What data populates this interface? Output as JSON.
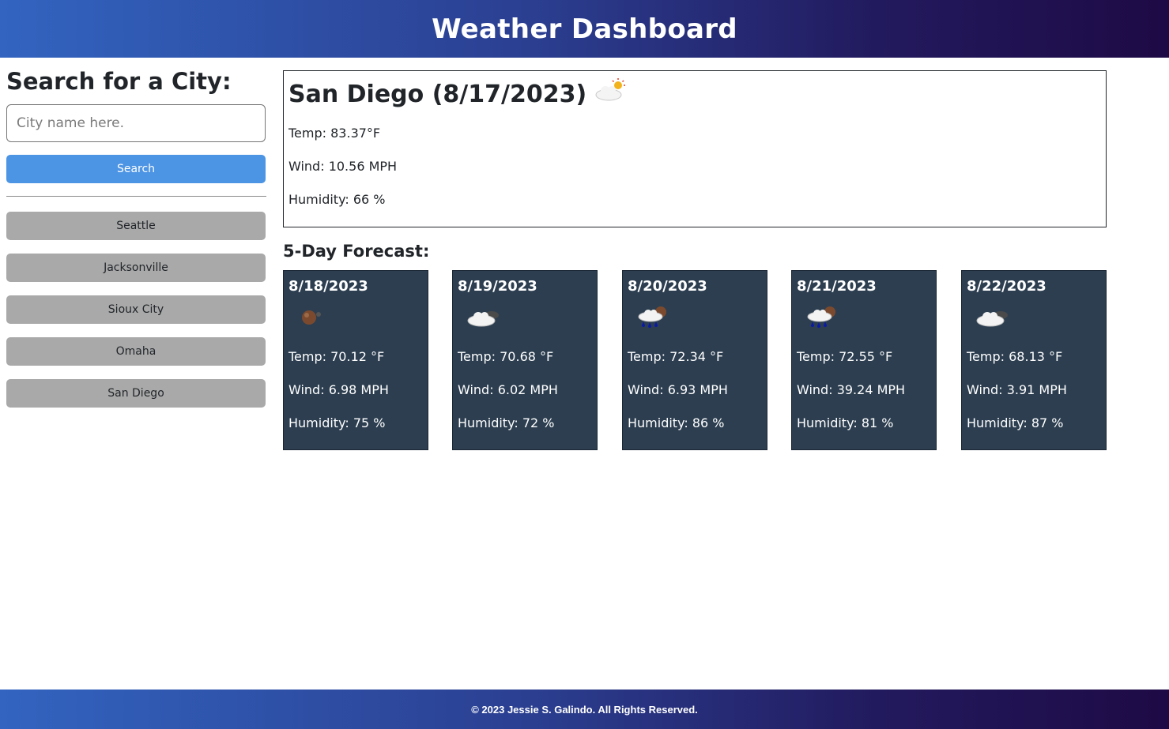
{
  "header": {
    "title": "Weather Dashboard"
  },
  "search": {
    "heading": "Search for a City:",
    "placeholder": "City name here.",
    "button_label": "Search"
  },
  "history": [
    "Seattle",
    "Jacksonville",
    "Sioux City",
    "Omaha",
    "San Diego"
  ],
  "current": {
    "title": "San Diego (8/17/2023)",
    "icon": "few-clouds-day-icon",
    "temp": "Temp: 83.37°F",
    "wind": "Wind: 10.56 MPH",
    "humidity": "Humidity: 66 %"
  },
  "forecast": {
    "heading": "5-Day Forecast:",
    "days": [
      {
        "date": "8/18/2023",
        "icon": "clear-night-icon",
        "temp": "Temp: 70.12 °F",
        "wind": "Wind: 6.98 MPH",
        "humidity": "Humidity: 75 %"
      },
      {
        "date": "8/19/2023",
        "icon": "cloudy-night-icon",
        "temp": "Temp: 70.68 °F",
        "wind": "Wind: 6.02 MPH",
        "humidity": "Humidity: 72 %"
      },
      {
        "date": "8/20/2023",
        "icon": "rain-night-icon",
        "temp": "Temp: 72.34 °F",
        "wind": "Wind: 6.93 MPH",
        "humidity": "Humidity: 86 %"
      },
      {
        "date": "8/21/2023",
        "icon": "rain-night-icon",
        "temp": "Temp: 72.55 °F",
        "wind": "Wind: 39.24 MPH",
        "humidity": "Humidity: 81 %"
      },
      {
        "date": "8/22/2023",
        "icon": "cloudy-night-icon",
        "temp": "Temp: 68.13 °F",
        "wind": "Wind: 3.91 MPH",
        "humidity": "Humidity: 87 %"
      }
    ]
  },
  "footer": {
    "text": "© 2023 Jessie S. Galindo. All Rights Reserved."
  },
  "colors": {
    "card_bg": "#2c3e50",
    "search_button": "#4c94e4",
    "history_button": "#a9a9a9"
  }
}
